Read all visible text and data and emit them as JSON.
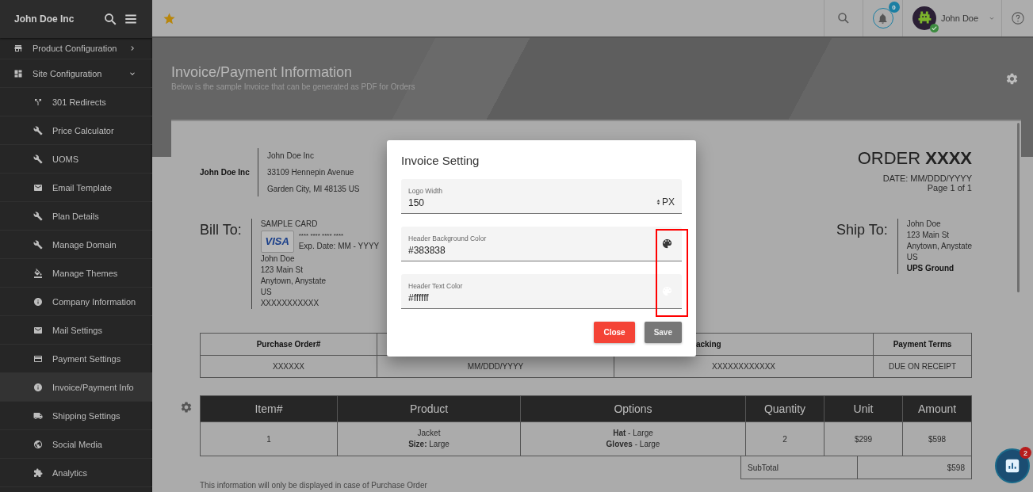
{
  "sidebar": {
    "brand": "John Doe Inc",
    "items": [
      {
        "label": "Product Configuration",
        "expanded": false
      },
      {
        "label": "Site Configuration",
        "expanded": true,
        "children": [
          {
            "label": "301 Redirects",
            "selected": false
          },
          {
            "label": "Price Calculator",
            "selected": false
          },
          {
            "label": "UOMS",
            "selected": false
          },
          {
            "label": "Email Template",
            "selected": false
          },
          {
            "label": "Plan Details",
            "selected": false
          },
          {
            "label": "Manage Domain",
            "selected": false
          },
          {
            "label": "Manage Themes",
            "selected": false
          },
          {
            "label": "Company Information",
            "selected": false
          },
          {
            "label": "Mail Settings",
            "selected": false
          },
          {
            "label": "Payment Settings",
            "selected": false
          },
          {
            "label": "Invoice/Payment Info",
            "selected": true
          },
          {
            "label": "Shipping Settings",
            "selected": false
          },
          {
            "label": "Social Media",
            "selected": false
          },
          {
            "label": "Analytics",
            "selected": false
          }
        ]
      }
    ]
  },
  "topbar": {
    "notification_count": "0",
    "user": "John Doe"
  },
  "page": {
    "title": "Invoice/Payment Information",
    "subtitle": "Below is the sample Invoice that can be generated as PDF for Orders"
  },
  "invoice": {
    "company": "John Doe Inc",
    "address": [
      "John Doe Inc",
      "33109 Hennepin Avenue",
      "Garden City, MI 48135 US"
    ],
    "order_label": "ORDER",
    "order_number": "XXXX",
    "date": "DATE: MM/DDD/YYYY",
    "page": "Page 1 of 1",
    "bill_to": {
      "heading": "Bill To:",
      "card_label": "SAMPLE CARD",
      "card_brand": "VISA",
      "card_number": "**** **** **** ****",
      "expiry": "Exp. Date: MM - YYYY",
      "lines": [
        "John Doe",
        "123 Main St",
        "Anytown, Anystate",
        "US",
        "XXXXXXXXXXX"
      ]
    },
    "ship_to": {
      "heading": "Ship To:",
      "lines": [
        "John Doe",
        "123 Main St",
        "Anytown, Anystate",
        "US"
      ],
      "method": "UPS Ground"
    },
    "info_table": {
      "columns": [
        "Purchase Order#",
        null,
        "acking",
        "Payment Terms"
      ],
      "rows": [
        [
          "XXXXXX",
          "MM/DDD/YYYY",
          "XXXXXXXXXXXX",
          "DUE ON RECEIPT"
        ]
      ]
    },
    "items_table": {
      "columns": [
        "Item#",
        "Product",
        "Options",
        "Quantity",
        "Unit",
        "Amount"
      ],
      "rows": [
        {
          "item": "1",
          "product": "Jacket",
          "product_detail": "**Size:** Large",
          "options": [
            "**Hat** - Large",
            "**Gloves** - Large"
          ],
          "quantity": "2",
          "unit": "$299",
          "amount": "$598"
        }
      ]
    },
    "totals": [
      {
        "label": "SubTotal",
        "value": "$598"
      }
    ],
    "note": "This information will only be displayed in case of Purchase Order"
  },
  "chat": {
    "badge": "2"
  },
  "modal": {
    "title": "Invoice Setting",
    "fields": [
      {
        "kind": "number",
        "label": "Logo Width",
        "value": "150",
        "unit": "PX"
      },
      {
        "kind": "color",
        "label": "Header Background Color",
        "value": "#383838"
      },
      {
        "kind": "color",
        "label": "Header Text Color",
        "value": "#ffffff"
      }
    ],
    "buttons": [
      {
        "kind": "close",
        "label": "Close"
      },
      {
        "kind": "save",
        "label": "Save"
      }
    ]
  }
}
